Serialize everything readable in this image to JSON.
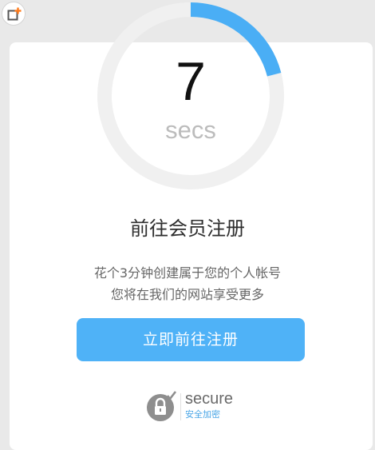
{
  "countdown": {
    "value": "7",
    "unit": "secs",
    "progress": 0.21,
    "ring_color": "#4aaef5",
    "track_color": "#f0f0f0"
  },
  "title": "前往会员注册",
  "description": {
    "line1": "花个3分钟创建属于您的个人帐号",
    "line2": "您将在我们的网站享受更多"
  },
  "register_button": {
    "label": "立即前往注册",
    "color": "#4fb2f7"
  },
  "secure": {
    "label": "secure",
    "sublabel": "安全加密",
    "icon": "lock-check-icon"
  },
  "corner_button": {
    "icon": "add-window-icon",
    "accent": "#ff7a1a"
  }
}
